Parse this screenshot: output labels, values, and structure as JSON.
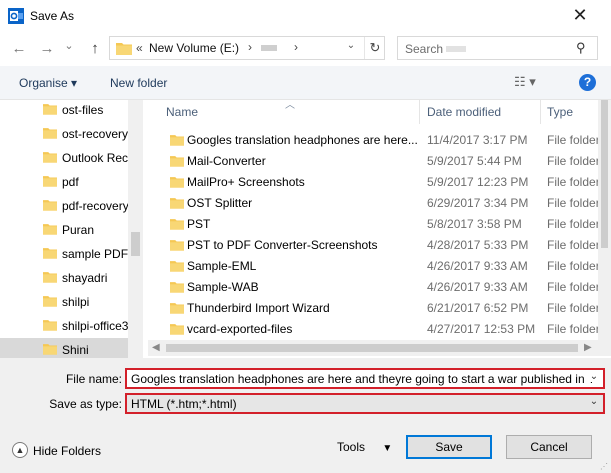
{
  "window": {
    "title": "Save As",
    "close_glyph": "✕"
  },
  "nav": {
    "back_glyph": "←",
    "forward_glyph": "→",
    "recent_glyph": "⌄",
    "up_glyph": "↑",
    "breadcrumb": [
      "«",
      "New Volume (E:)",
      "›",
      "›"
    ],
    "refresh_glyph": "↻",
    "search_placeholder": "Search"
  },
  "toolbar": {
    "organise": "Organise ▾",
    "new_folder": "New folder",
    "view_glyph": "☷ ▾",
    "help_glyph": "?"
  },
  "sidebar": {
    "items": [
      {
        "label": "ost-files"
      },
      {
        "label": "ost-recovery"
      },
      {
        "label": "Outlook Rec"
      },
      {
        "label": "pdf"
      },
      {
        "label": "pdf-recovery"
      },
      {
        "label": "Puran"
      },
      {
        "label": "sample PDF"
      },
      {
        "label": "shayadri"
      },
      {
        "label": "shilpi"
      },
      {
        "label": "shilpi-office3"
      },
      {
        "label": "Shini",
        "selected": true
      }
    ]
  },
  "files": {
    "columns": {
      "name": "Name",
      "date": "Date modified",
      "type": "Type"
    },
    "rows": [
      {
        "name": "Googles translation headphones are here...",
        "date": "11/4/2017 3:17 PM",
        "type": "File folder"
      },
      {
        "name": "Mail-Converter",
        "date": "5/9/2017 5:44 PM",
        "type": "File folder"
      },
      {
        "name": "MailPro+ Screenshots",
        "date": "5/9/2017 12:23 PM",
        "type": "File folder"
      },
      {
        "name": "OST Splitter",
        "date": "6/29/2017 3:34 PM",
        "type": "File folder"
      },
      {
        "name": "PST",
        "date": "5/8/2017 3:58 PM",
        "type": "File folder"
      },
      {
        "name": "PST to PDF Converter-Screenshots",
        "date": "4/28/2017 5:33 PM",
        "type": "File folder"
      },
      {
        "name": "Sample-EML",
        "date": "4/26/2017 9:33 AM",
        "type": "File folder"
      },
      {
        "name": "Sample-WAB",
        "date": "4/26/2017 9:33 AM",
        "type": "File folder"
      },
      {
        "name": "Thunderbird Import Wizard",
        "date": "6/21/2017 6:52 PM",
        "type": "File folder"
      },
      {
        "name": "vcard-exported-files",
        "date": "4/27/2017 12:53 PM",
        "type": "File folder"
      }
    ]
  },
  "form": {
    "file_name_label": "File name:",
    "file_name_value": "Googles translation headphones are here and theyre going to start a war published in T",
    "save_type_label": "Save as type:",
    "save_type_value": "HTML (*.htm;*.html)"
  },
  "footer": {
    "hide_folders": "Hide Folders",
    "tools": "Tools",
    "save": "Save",
    "cancel": "Cancel"
  },
  "colors": {
    "accent": "#0078d7",
    "highlight_border": "#d3202a",
    "folder": "#f5c854",
    "app_icon": "#0a64c8"
  }
}
